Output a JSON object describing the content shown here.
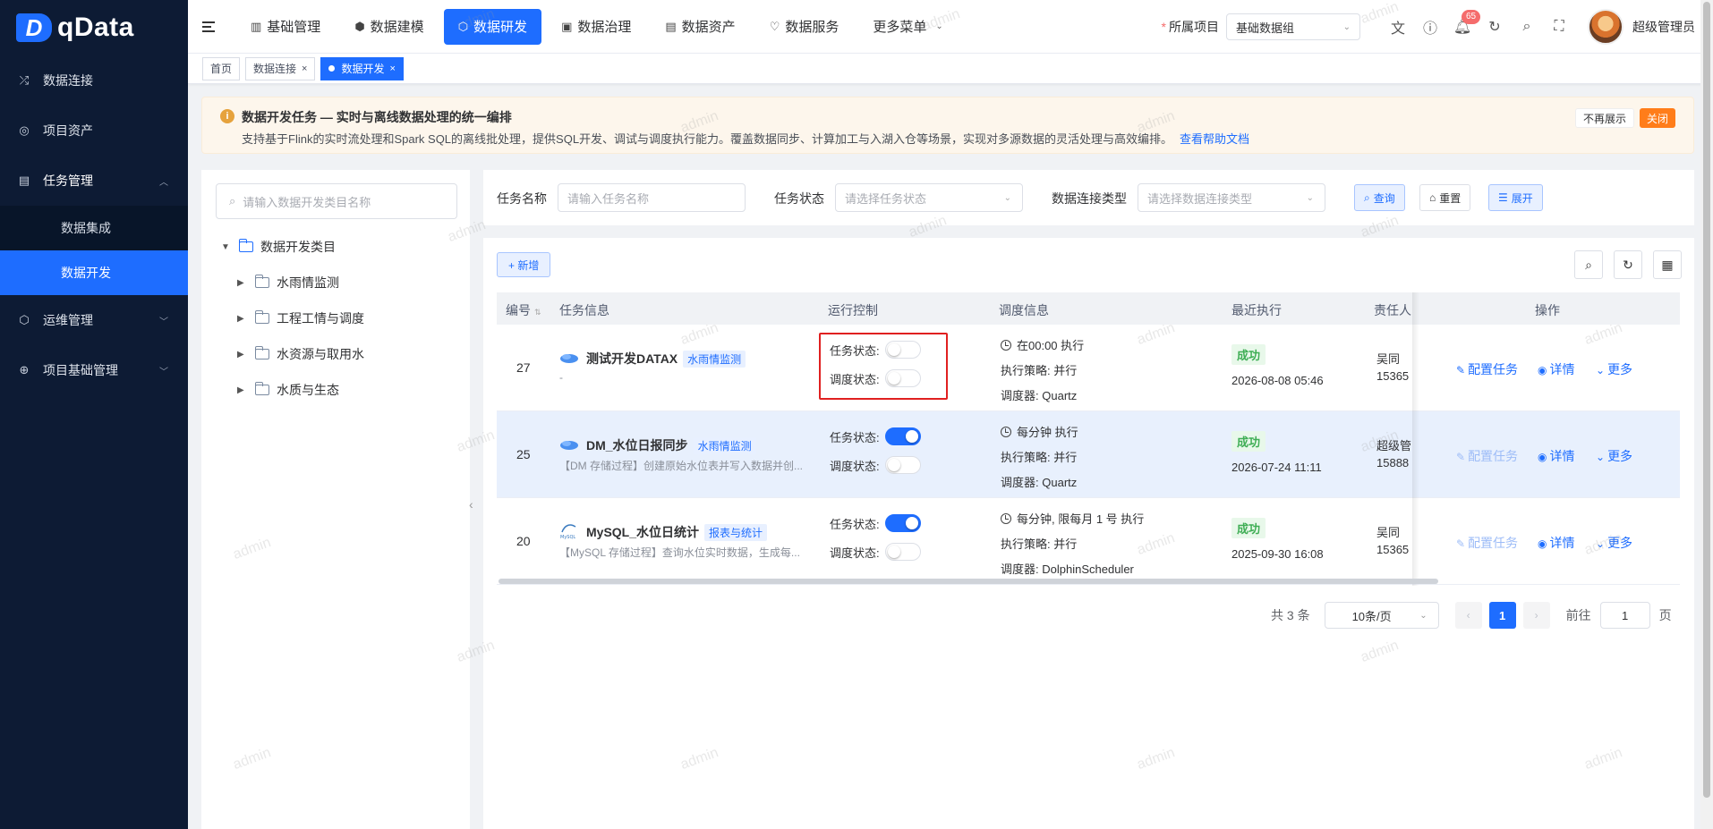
{
  "sidebar": {
    "logo": "qData",
    "items": [
      {
        "label": "数据连接",
        "icon": "shuffle-icon"
      },
      {
        "label": "项目资产",
        "icon": "asset-icon"
      },
      {
        "label": "任务管理",
        "icon": "task-icon",
        "expanded": true,
        "children": [
          {
            "label": "数据集成",
            "active": false
          },
          {
            "label": "数据开发",
            "active": true
          }
        ]
      },
      {
        "label": "运维管理",
        "icon": "cube-icon"
      },
      {
        "label": "项目基础管理",
        "icon": "globe-icon"
      }
    ]
  },
  "header": {
    "nav": [
      {
        "label": "基础管理",
        "icon": "doc-icon"
      },
      {
        "label": "数据建模",
        "icon": "model-icon"
      },
      {
        "label": "数据研发",
        "icon": "dev-icon",
        "active": true
      },
      {
        "label": "数据治理",
        "icon": "govern-icon"
      },
      {
        "label": "数据资产",
        "icon": "asset-icon"
      },
      {
        "label": "数据服务",
        "icon": "service-icon"
      },
      {
        "label": "更多菜单",
        "icon": ""
      }
    ],
    "project_label": "所属项目",
    "project_value": "基础数据组",
    "notification_count": "65",
    "user_name": "超级管理员"
  },
  "tabs": [
    {
      "label": "首页",
      "closable": false,
      "active": false
    },
    {
      "label": "数据连接",
      "closable": true,
      "active": false
    },
    {
      "label": "数据开发",
      "closable": true,
      "active": true
    }
  ],
  "alert": {
    "title": "数据开发任务 — 实时与离线数据处理的统一编排",
    "desc": "支持基于Flink的实时流处理和Spark SQL的离线批处理，提供SQL开发、调试与调度执行能力。覆盖数据同步、计算加工与入湖入仓等场景，实现对多源数据的灵活处理与高效编排。",
    "link": "查看帮助文档",
    "hide_label": "不再展示",
    "close_label": "关闭"
  },
  "tree": {
    "search_placeholder": "请输入数据开发类目名称",
    "root": "数据开发类目",
    "children": [
      "水雨情监测",
      "工程工情与调度",
      "水资源与取用水",
      "水质与生态"
    ]
  },
  "filters": {
    "name_label": "任务名称",
    "name_placeholder": "请输入任务名称",
    "status_label": "任务状态",
    "status_placeholder": "请选择任务状态",
    "conn_label": "数据连接类型",
    "conn_placeholder": "请选择数据连接类型",
    "query_label": "查询",
    "reset_label": "重置",
    "expand_label": "展开"
  },
  "table": {
    "add_label": "+ 新增",
    "columns": [
      "编号",
      "任务信息",
      "运行控制",
      "调度信息",
      "最近执行",
      "责任人",
      "操作"
    ],
    "task_status_label": "任务状态:",
    "sched_status_label": "调度状态:",
    "strategy_label": "执行策略:",
    "scheduler_label": "调度器:",
    "ops": {
      "config": "配置任务",
      "detail": "详情",
      "more": "更多"
    },
    "rows": [
      {
        "id": "27",
        "name": "测试开发DATAX",
        "tag": "水雨情监测",
        "desc": "-",
        "task_on": false,
        "sched_on": false,
        "cron": "在00:00 执行",
        "strategy": "并行",
        "scheduler": "Quartz",
        "status": "成功",
        "last_run": "2026-08-08 05:46",
        "owner": "吴同",
        "phone": "15365",
        "config_enabled": true
      },
      {
        "id": "25",
        "name": "DM_水位日报同步",
        "tag": "水雨情监测",
        "desc": "【DM 存储过程】创建原始水位表并写入数据并创...",
        "task_on": true,
        "sched_on": false,
        "cron": "每分钟 执行",
        "strategy": "并行",
        "scheduler": "Quartz",
        "status": "成功",
        "last_run": "2026-07-24 11:11",
        "owner": "超级管",
        "phone": "15888",
        "config_enabled": false
      },
      {
        "id": "20",
        "name": "MySQL_水位日统计",
        "tag": "报表与统计",
        "desc": "【MySQL 存储过程】查询水位实时数据，生成每...",
        "task_on": true,
        "sched_on": false,
        "cron": "每分钟, 限每月 1 号 执行",
        "strategy": "并行",
        "scheduler": "DolphinScheduler",
        "status": "成功",
        "last_run": "2025-09-30 16:08",
        "owner": "吴同",
        "phone": "15365",
        "config_enabled": false
      }
    ]
  },
  "pagination": {
    "total": "共 3 条",
    "page_size": "10条/页",
    "current": "1",
    "goto_label": "前往",
    "goto_value": "1",
    "page_suffix": "页"
  },
  "watermark": "admin",
  "colors": {
    "primary": "#1e6dff",
    "sidebar": "#0d1b34",
    "success": "#3fae55",
    "warning": "#e6a23c",
    "highlight": "#e02020"
  }
}
